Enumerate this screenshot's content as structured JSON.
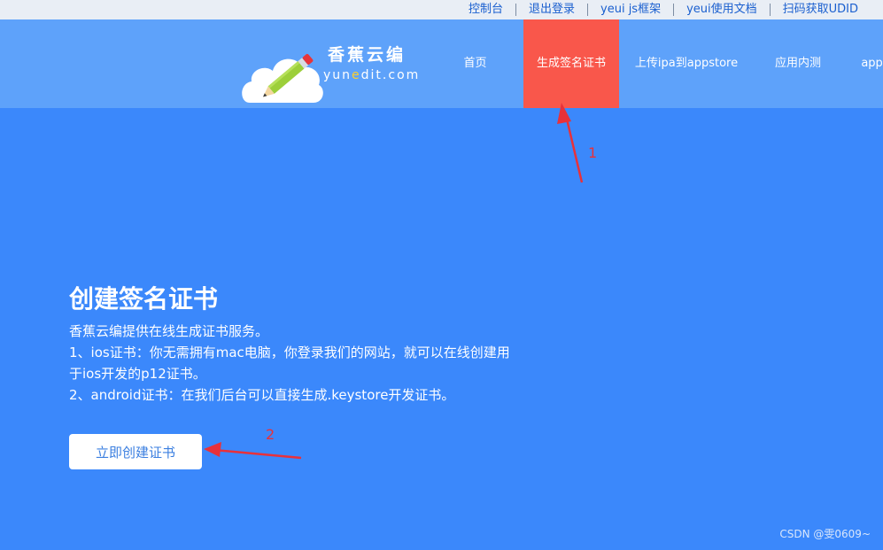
{
  "top_links": [
    "控制台",
    "退出登录",
    "yeui js框架",
    "yeui使用文档",
    "扫码获取UDID"
  ],
  "logo": {
    "title_cn": "香蕉云编",
    "domain_pre": "yun",
    "domain_e": "e",
    "domain_post": "dit.com"
  },
  "nav": {
    "items": [
      "首页",
      "生成签名证书",
      "上传ipa到appstore",
      "应用内测",
      "appstore"
    ],
    "active_index": 1
  },
  "hero": {
    "title": "创建签名证书",
    "lines": [
      "香蕉云编提供在线生成证书服务。",
      "1、ios证书：你无需拥有mac电脑，你登录我们的网站，就可以在线创建用于ios开发的p12证书。",
      "2、android证书：在我们后台可以直接生成.keystore开发证书。"
    ],
    "button_label": "立即创建证书"
  },
  "annotations": {
    "label_1": "1",
    "label_2": "2",
    "color": "#e8313a"
  },
  "watermark": "CSDN @雯0609~",
  "colors": {
    "background": "#3b88fb",
    "nav_bg": "#5ea2fa",
    "active_nav": "#f9574b",
    "top_link": "#1a5fcf"
  }
}
